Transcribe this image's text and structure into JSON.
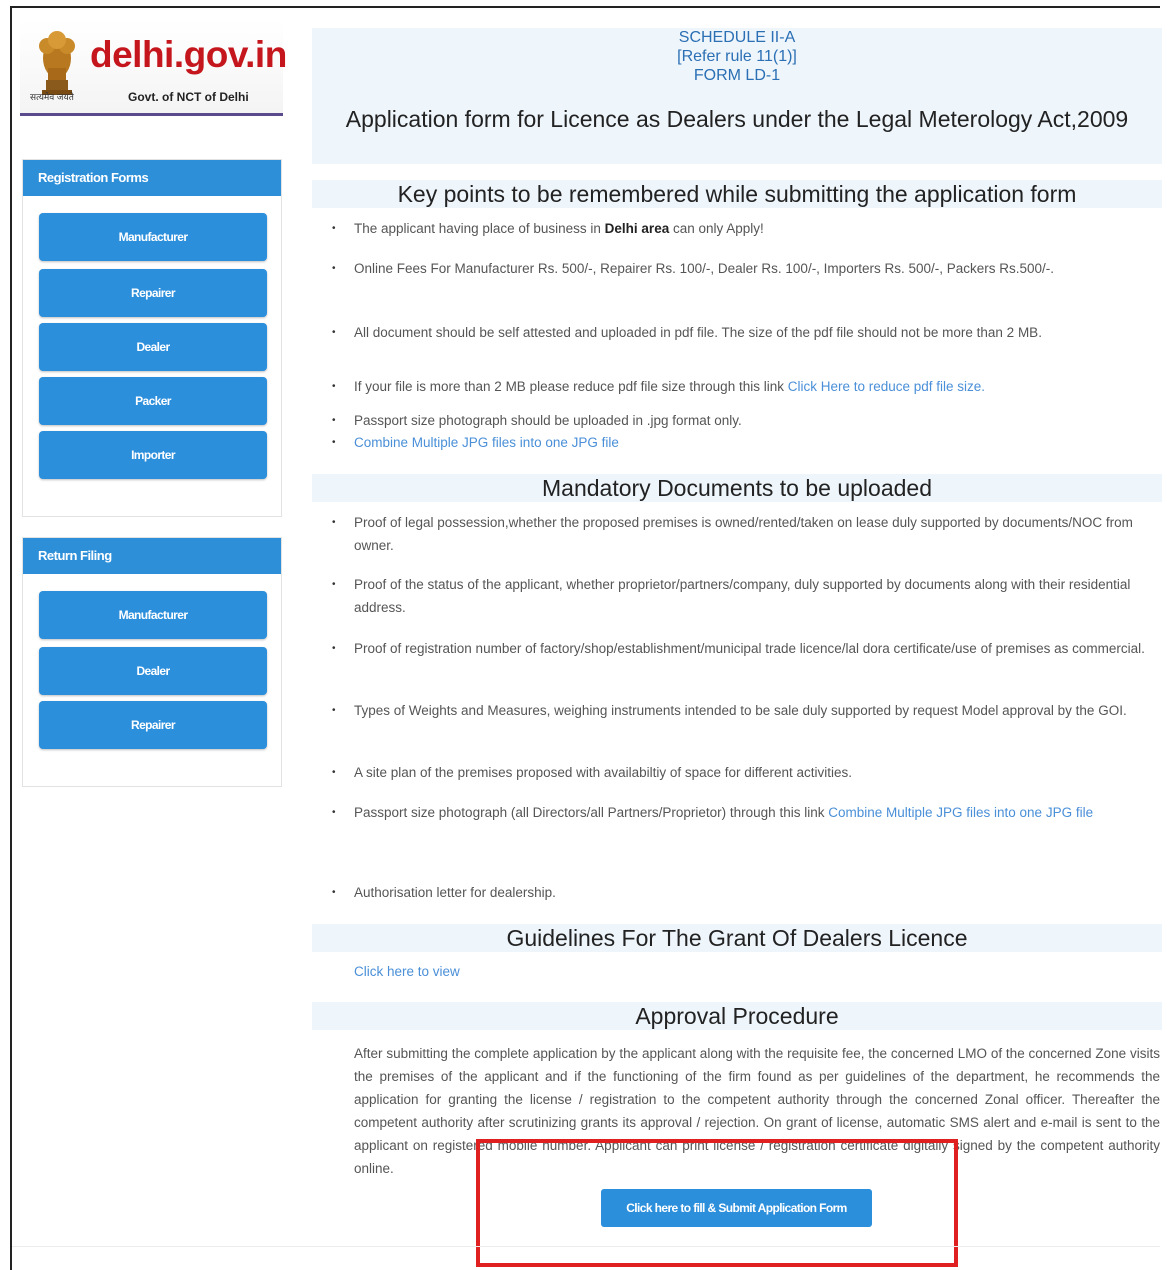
{
  "logo": {
    "site": "delhi.gov.in",
    "hindi": "सत्यमेव जयते",
    "subtitle": "Govt. of NCT of Delhi"
  },
  "sidebar": {
    "registration": {
      "title": "Registration Forms",
      "items": [
        "Manufacturer",
        "Repairer",
        "Dealer",
        "Packer",
        "Importer"
      ]
    },
    "return_filing": {
      "title": "Return Filing",
      "items": [
        "Manufacturer",
        "Dealer",
        "Repairer"
      ]
    }
  },
  "header": {
    "schedule": "SCHEDULE II-A",
    "rule": "[Refer rule 11(1)]",
    "form": "FORM LD-1",
    "title": "Application form for Licence as Dealers under the Legal Meterology Act,2009"
  },
  "key_points": {
    "heading": "Key points to be remembered while submitting the application form",
    "items": [
      {
        "pre": "The applicant having place of business in ",
        "strong": "Delhi area",
        "post": " can only Apply!"
      },
      {
        "text": "Online Fees For Manufacturer Rs. 500/-, Repairer Rs. 100/-, Dealer Rs. 100/-, Importers Rs. 500/-, Packers Rs.500/-."
      },
      {
        "text": "All document should be self attested and uploaded in pdf file. The size of the pdf file should not be more than 2 MB."
      },
      {
        "pre": "If your file is more than 2 MB please reduce pdf file size through this link ",
        "link": "Click Here to reduce pdf file size."
      },
      {
        "text": "Passport size photograph should be uploaded in .jpg format only."
      },
      {
        "link": "Combine Multiple JPG files into one JPG file"
      }
    ]
  },
  "mandatory_docs": {
    "heading": "Mandatory Documents to be uploaded",
    "items": [
      {
        "text": "Proof of legal possession,whether the proposed premises is owned/rented/taken on lease duly supported by documents/NOC from owner."
      },
      {
        "text": "Proof of the status of the applicant, whether proprietor/partners/company, duly supported by documents along with their residential address."
      },
      {
        "text": "Proof of registration number of factory/shop/establishment/municipal trade licence/lal dora certificate/use of premises as commercial."
      },
      {
        "text": "Types of Weights and Measures, weighing instruments intended to be sale duly supported by request Model approval by the GOI."
      },
      {
        "text": "A site plan of the premises proposed with availabiltiy of space for different activities."
      },
      {
        "pre": "Passport size photograph (all Directors/all Partners/Proprietor) through this link ",
        "link": "Combine Multiple JPG files into one JPG file"
      },
      {
        "text": "Authorisation letter for dealership."
      }
    ]
  },
  "guidelines": {
    "heading": "Guidelines For The Grant Of Dealers Licence",
    "link": "Click here to view"
  },
  "approval": {
    "heading": "Approval Procedure",
    "text": "After submitting the complete application by the applicant along with the requisite fee, the concerned LMO of the concerned Zone visits the premises of the applicant and if the functioning of the firm found as per guidelines of the department, he recommends the application for granting the license / registration to the competent authority through the concerned Zonal officer. Thereafter the competent authority after scrutinizing grants its approval / rejection. On grant of license, automatic SMS alert and e-mail is sent to the applicant on registered mobile number. Applicant can print license / registration certificate digitally signed by the competent authority online.",
    "submit_label": "Click here to fill & Submit Application Form"
  },
  "colors": {
    "accent": "#2c8fdc",
    "section_bg": "#eef5fb",
    "link": "#4a8fd8",
    "highlight": "#e02020",
    "logo_red": "#c4161c"
  }
}
